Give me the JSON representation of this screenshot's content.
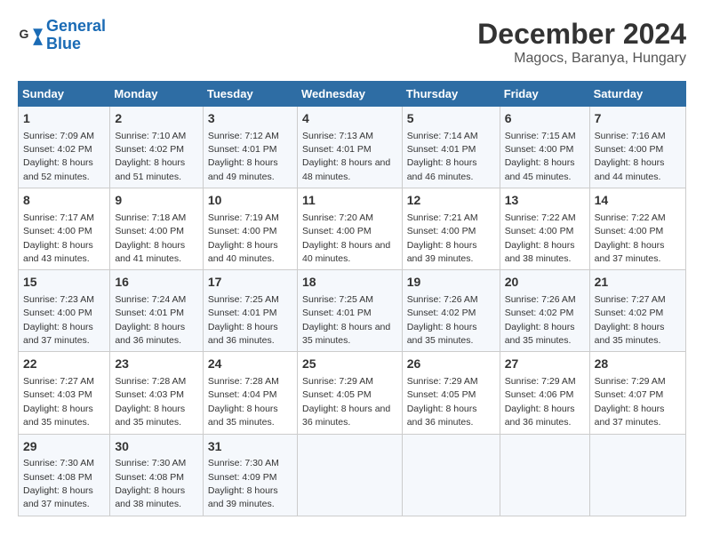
{
  "logo": {
    "text_general": "General",
    "text_blue": "Blue"
  },
  "header": {
    "title": "December 2024",
    "subtitle": "Magocs, Baranya, Hungary"
  },
  "columns": [
    "Sunday",
    "Monday",
    "Tuesday",
    "Wednesday",
    "Thursday",
    "Friday",
    "Saturday"
  ],
  "rows": [
    [
      {
        "day": "1",
        "sunrise": "7:09 AM",
        "sunset": "4:02 PM",
        "daylight": "8 hours and 52 minutes."
      },
      {
        "day": "2",
        "sunrise": "7:10 AM",
        "sunset": "4:02 PM",
        "daylight": "8 hours and 51 minutes."
      },
      {
        "day": "3",
        "sunrise": "7:12 AM",
        "sunset": "4:01 PM",
        "daylight": "8 hours and 49 minutes."
      },
      {
        "day": "4",
        "sunrise": "7:13 AM",
        "sunset": "4:01 PM",
        "daylight": "8 hours and 48 minutes."
      },
      {
        "day": "5",
        "sunrise": "7:14 AM",
        "sunset": "4:01 PM",
        "daylight": "8 hours and 46 minutes."
      },
      {
        "day": "6",
        "sunrise": "7:15 AM",
        "sunset": "4:00 PM",
        "daylight": "8 hours and 45 minutes."
      },
      {
        "day": "7",
        "sunrise": "7:16 AM",
        "sunset": "4:00 PM",
        "daylight": "8 hours and 44 minutes."
      }
    ],
    [
      {
        "day": "8",
        "sunrise": "7:17 AM",
        "sunset": "4:00 PM",
        "daylight": "8 hours and 43 minutes."
      },
      {
        "day": "9",
        "sunrise": "7:18 AM",
        "sunset": "4:00 PM",
        "daylight": "8 hours and 41 minutes."
      },
      {
        "day": "10",
        "sunrise": "7:19 AM",
        "sunset": "4:00 PM",
        "daylight": "8 hours and 40 minutes."
      },
      {
        "day": "11",
        "sunrise": "7:20 AM",
        "sunset": "4:00 PM",
        "daylight": "8 hours and 40 minutes."
      },
      {
        "day": "12",
        "sunrise": "7:21 AM",
        "sunset": "4:00 PM",
        "daylight": "8 hours and 39 minutes."
      },
      {
        "day": "13",
        "sunrise": "7:22 AM",
        "sunset": "4:00 PM",
        "daylight": "8 hours and 38 minutes."
      },
      {
        "day": "14",
        "sunrise": "7:22 AM",
        "sunset": "4:00 PM",
        "daylight": "8 hours and 37 minutes."
      }
    ],
    [
      {
        "day": "15",
        "sunrise": "7:23 AM",
        "sunset": "4:00 PM",
        "daylight": "8 hours and 37 minutes."
      },
      {
        "day": "16",
        "sunrise": "7:24 AM",
        "sunset": "4:01 PM",
        "daylight": "8 hours and 36 minutes."
      },
      {
        "day": "17",
        "sunrise": "7:25 AM",
        "sunset": "4:01 PM",
        "daylight": "8 hours and 36 minutes."
      },
      {
        "day": "18",
        "sunrise": "7:25 AM",
        "sunset": "4:01 PM",
        "daylight": "8 hours and 35 minutes."
      },
      {
        "day": "19",
        "sunrise": "7:26 AM",
        "sunset": "4:02 PM",
        "daylight": "8 hours and 35 minutes."
      },
      {
        "day": "20",
        "sunrise": "7:26 AM",
        "sunset": "4:02 PM",
        "daylight": "8 hours and 35 minutes."
      },
      {
        "day": "21",
        "sunrise": "7:27 AM",
        "sunset": "4:02 PM",
        "daylight": "8 hours and 35 minutes."
      }
    ],
    [
      {
        "day": "22",
        "sunrise": "7:27 AM",
        "sunset": "4:03 PM",
        "daylight": "8 hours and 35 minutes."
      },
      {
        "day": "23",
        "sunrise": "7:28 AM",
        "sunset": "4:03 PM",
        "daylight": "8 hours and 35 minutes."
      },
      {
        "day": "24",
        "sunrise": "7:28 AM",
        "sunset": "4:04 PM",
        "daylight": "8 hours and 35 minutes."
      },
      {
        "day": "25",
        "sunrise": "7:29 AM",
        "sunset": "4:05 PM",
        "daylight": "8 hours and 36 minutes."
      },
      {
        "day": "26",
        "sunrise": "7:29 AM",
        "sunset": "4:05 PM",
        "daylight": "8 hours and 36 minutes."
      },
      {
        "day": "27",
        "sunrise": "7:29 AM",
        "sunset": "4:06 PM",
        "daylight": "8 hours and 36 minutes."
      },
      {
        "day": "28",
        "sunrise": "7:29 AM",
        "sunset": "4:07 PM",
        "daylight": "8 hours and 37 minutes."
      }
    ],
    [
      {
        "day": "29",
        "sunrise": "7:30 AM",
        "sunset": "4:08 PM",
        "daylight": "8 hours and 37 minutes."
      },
      {
        "day": "30",
        "sunrise": "7:30 AM",
        "sunset": "4:08 PM",
        "daylight": "8 hours and 38 minutes."
      },
      {
        "day": "31",
        "sunrise": "7:30 AM",
        "sunset": "4:09 PM",
        "daylight": "8 hours and 39 minutes."
      },
      null,
      null,
      null,
      null
    ]
  ]
}
